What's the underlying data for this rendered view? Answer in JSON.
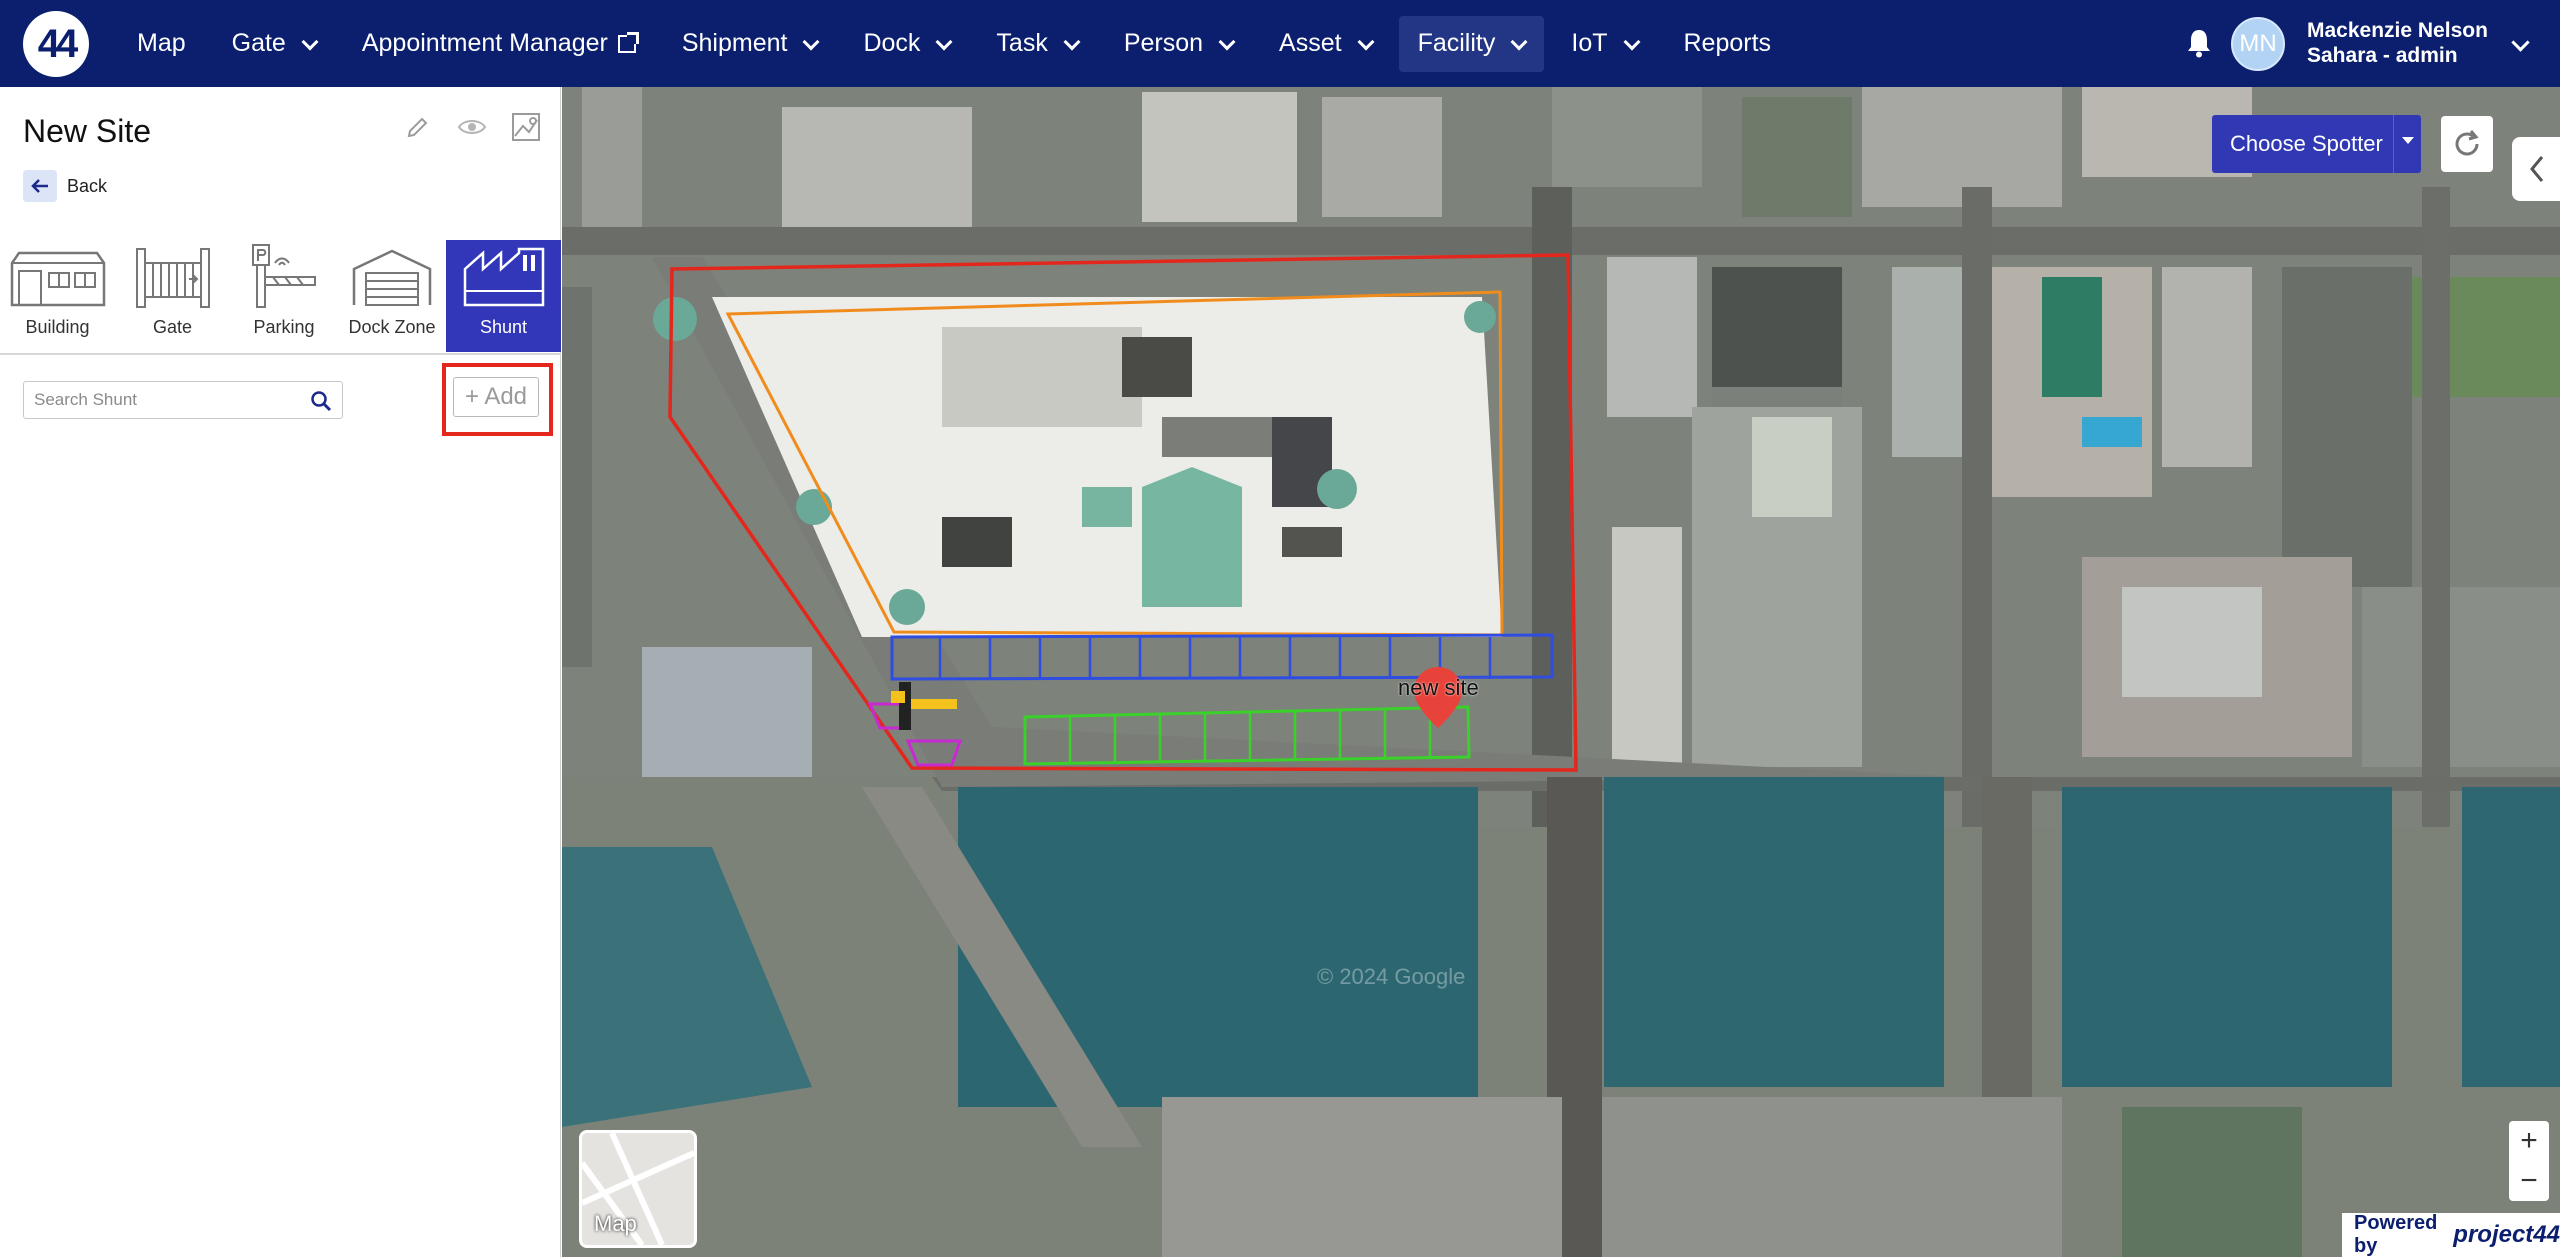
{
  "nav": {
    "logo": "44",
    "items": [
      {
        "label": "Map",
        "dropdown": false
      },
      {
        "label": "Gate",
        "dropdown": true
      },
      {
        "label": "Appointment Manager",
        "external": true
      },
      {
        "label": "Shipment",
        "dropdown": true
      },
      {
        "label": "Dock",
        "dropdown": true
      },
      {
        "label": "Task",
        "dropdown": true
      },
      {
        "label": "Person",
        "dropdown": true
      },
      {
        "label": "Asset",
        "dropdown": true
      },
      {
        "label": "Facility",
        "dropdown": true,
        "active": true
      },
      {
        "label": "IoT",
        "dropdown": true
      },
      {
        "label": "Reports",
        "dropdown": false
      }
    ]
  },
  "user": {
    "initials": "MN",
    "name": "Mackenzie Nelson",
    "role": "Sahara - admin"
  },
  "panel": {
    "title": "New Site",
    "back_label": "Back",
    "types": [
      {
        "label": "Building",
        "icon": "building-icon"
      },
      {
        "label": "Gate",
        "icon": "gate-icon"
      },
      {
        "label": "Parking",
        "icon": "parking-icon"
      },
      {
        "label": "Dock Zone",
        "icon": "dock-zone-icon"
      },
      {
        "label": "Shunt",
        "icon": "shunt-icon",
        "active": true
      }
    ],
    "search_placeholder": "Search Shunt",
    "add_label": "+ Add"
  },
  "map": {
    "spotter_label": "Choose Spotter",
    "map_type_label": "Map",
    "site_marker_label": "new site",
    "zoom_in": "+",
    "zoom_out": "−",
    "powered_by": "Powered by",
    "powered_brand": "project44",
    "watermark": "© 2024 Google"
  },
  "colors": {
    "nav_bg": "#0b1f6e",
    "active_tab": "#3137b8",
    "highlight": "#e3271d",
    "site_outline": "#e3271d",
    "building_outline": "#f08c1c",
    "dock_outline": "#2f4de0",
    "parking_outline": "#3ad12a",
    "gate_outline": "#c82ad2"
  }
}
